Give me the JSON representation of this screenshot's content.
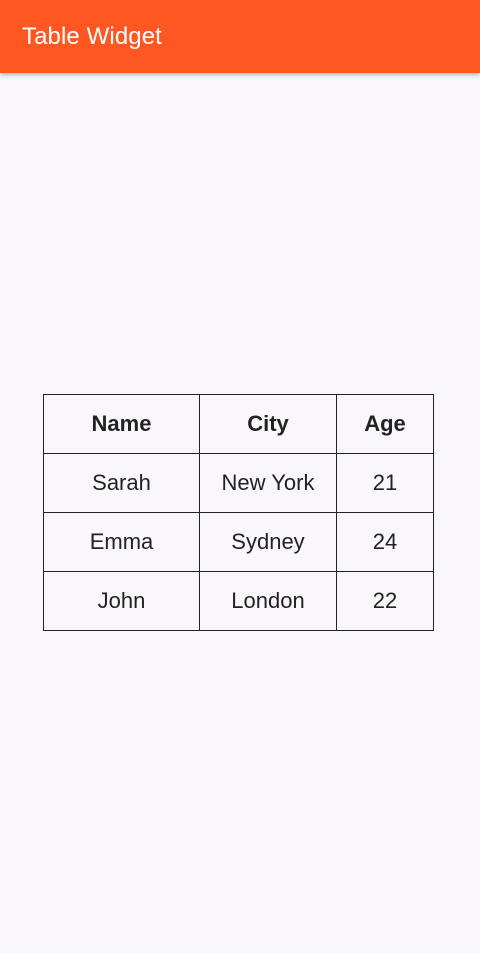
{
  "app_bar": {
    "title": "Table Widget",
    "color": "#ff5722"
  },
  "table": {
    "headers": {
      "name": "Name",
      "city": "City",
      "age": "Age"
    },
    "rows": [
      {
        "name": "Sarah",
        "city": "New York",
        "age": "21"
      },
      {
        "name": "Emma",
        "city": "Sydney",
        "age": "24"
      },
      {
        "name": "John",
        "city": "London",
        "age": "22"
      }
    ]
  }
}
